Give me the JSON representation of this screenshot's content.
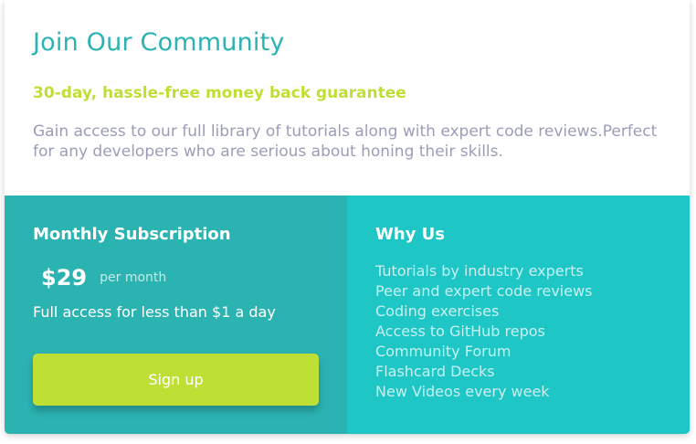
{
  "header": {
    "title": "Join Our Community",
    "guarantee": "30-day, hassle-free money back guarantee",
    "description": "Gain access to our full library of tutorials along with expert code reviews.Perfect for any developers who are serious about honing their skills."
  },
  "subscription": {
    "heading": "Monthly Subscription",
    "price": "$29",
    "period": "per month",
    "note": "Full access for less than $1 a day",
    "button_label": "Sign up"
  },
  "why": {
    "heading": "Why Us",
    "items": [
      "Tutorials by industry experts",
      "Peer and expert code reviews",
      "Coding exercises",
      "Access to GitHub repos",
      "Community Forum",
      "Flashcard Decks",
      "New Videos every week"
    ]
  },
  "colors": {
    "title": "#2bb3b1",
    "accent": "#bedf34",
    "muted_text": "#9b9db8",
    "left_panel": "#2bb3b1",
    "right_panel": "#1ec6c5"
  }
}
